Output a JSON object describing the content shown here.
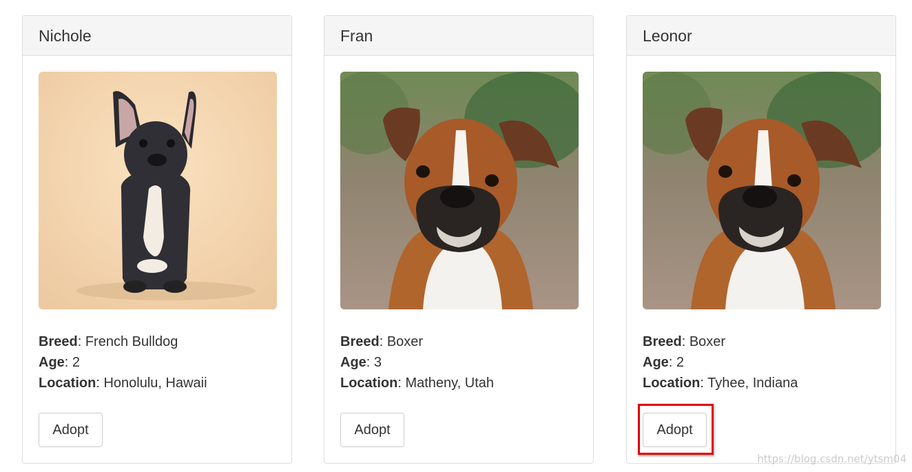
{
  "pets": [
    {
      "name": "Nichole",
      "photo": "french-bulldog-photo",
      "breed_label": "Breed",
      "breed": "French Bulldog",
      "age_label": "Age",
      "age": "2",
      "location_label": "Location",
      "location": "Honolulu, Hawaii",
      "button_label": "Adopt"
    },
    {
      "name": "Fran",
      "photo": "boxer-photo",
      "breed_label": "Breed",
      "breed": "Boxer",
      "age_label": "Age",
      "age": "3",
      "location_label": "Location",
      "location": "Matheny, Utah",
      "button_label": "Adopt"
    },
    {
      "name": "Leonor",
      "photo": "boxer-photo",
      "breed_label": "Breed",
      "breed": "Boxer",
      "age_label": "Age",
      "age": "2",
      "location_label": "Location",
      "location": "Tyhee, Indiana",
      "button_label": "Adopt"
    }
  ],
  "separator": ": ",
  "highlight_color": "#e00000",
  "watermark": "https://blog.csdn.net/ytsm04"
}
